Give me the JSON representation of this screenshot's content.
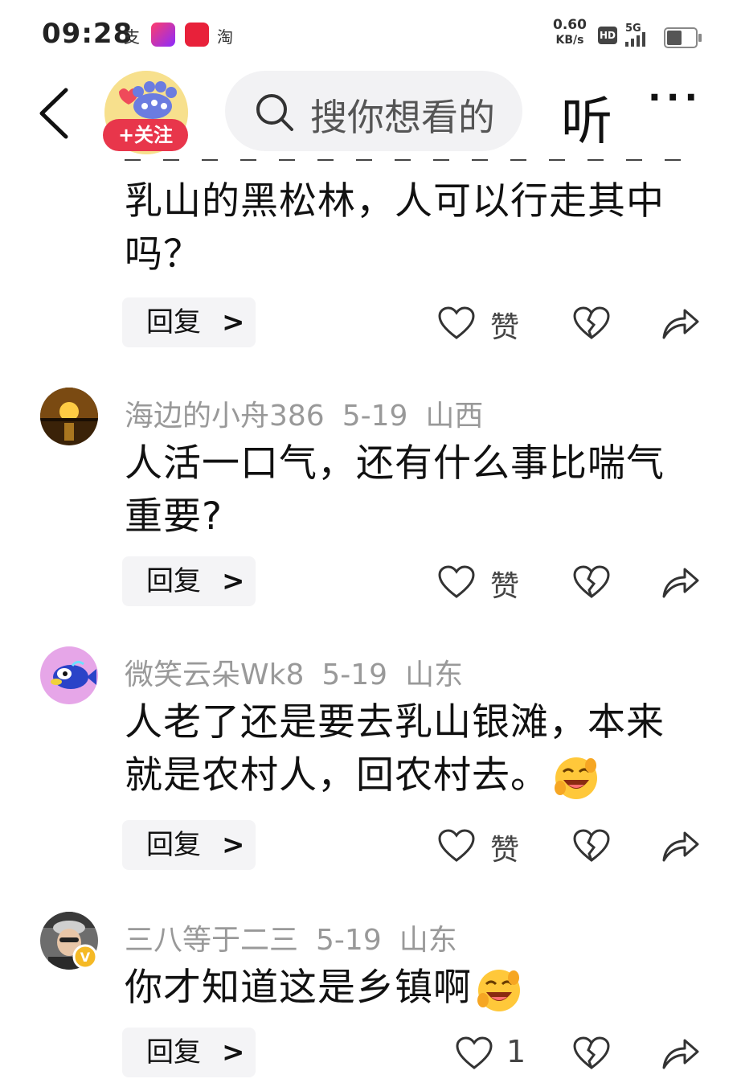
{
  "status_bar": {
    "time": "09:28",
    "app_icons": [
      "支",
      "淘"
    ],
    "net_speed_value": "0.60",
    "net_speed_unit": "KB/s",
    "hd": "HD",
    "signal": "5G"
  },
  "header": {
    "follow_label": "+关注",
    "search_placeholder": "搜你想看的",
    "listen_label": "听",
    "more_label": "···"
  },
  "comments": [
    {
      "text": "乳山的黑松林，人可以行走其中吗？",
      "reply_label": "回复",
      "like_label": "赞"
    },
    {
      "user": "海边的小舟386",
      "date": "5-19",
      "location": "山西",
      "text": "人活一口气，还有什么事比喘气重要?",
      "reply_label": "回复",
      "like_label": "赞"
    },
    {
      "user": "微笑云朵Wk8",
      "date": "5-19",
      "location": "山东",
      "text": "人老了还是要去乳山银滩，本来就是农村人，回农村去。",
      "reply_label": "回复",
      "like_label": "赞"
    },
    {
      "user": "三八等于二三",
      "date": "5-19",
      "location": "山东",
      "text": "你才知道这是乡镇啊",
      "reply_label": "回复",
      "like_count": "1"
    }
  ]
}
